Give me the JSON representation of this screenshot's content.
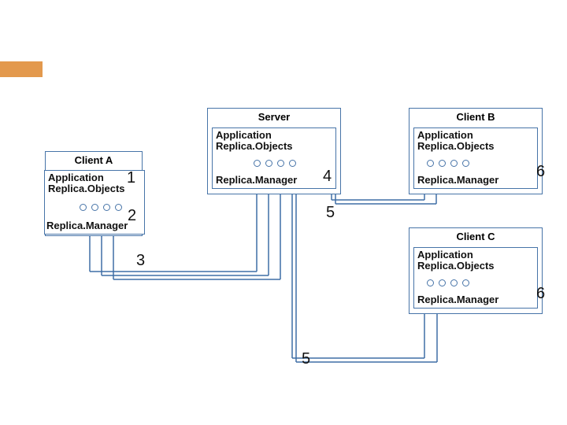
{
  "accent": {
    "color": "#e08e3a"
  },
  "nodes": {
    "clientA": {
      "title": "Client A",
      "app1": "Application",
      "app2": "Replica.Objects",
      "rm": "Replica.Manager"
    },
    "server": {
      "title": "Server",
      "app1": "Application",
      "app2": "Replica.Objects",
      "rm": "Replica.Manager"
    },
    "clientB": {
      "title": "Client B",
      "app1": "Application",
      "app2": "Replica.Objects",
      "rm": "Replica.Manager"
    },
    "clientC": {
      "title": "Client C",
      "app1": "Application",
      "app2": "Replica.Objects",
      "rm": "Replica.Manager"
    }
  },
  "numbers": {
    "n1": "1",
    "n2": "2",
    "n3": "3",
    "n4": "4",
    "n5a": "5",
    "n5b": "5",
    "n6a": "6",
    "n6b": "6"
  }
}
